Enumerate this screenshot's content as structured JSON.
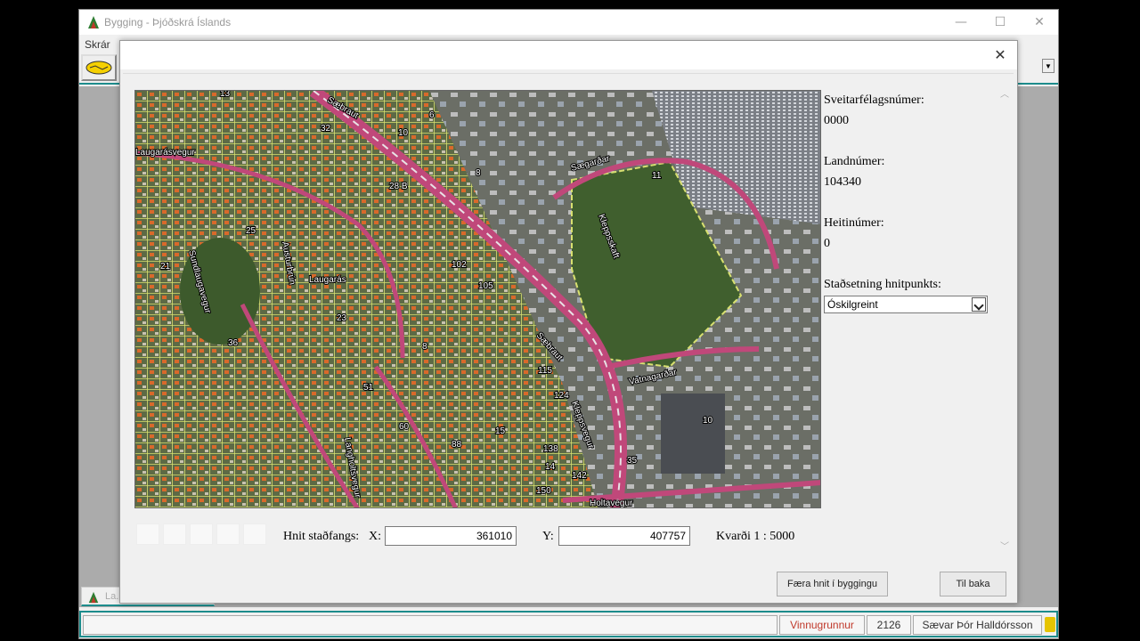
{
  "app": {
    "title": "Bygging - Þjóðskrá Íslands",
    "menu_file": "Skrár",
    "minimize_icon": "minimize-icon",
    "maximize_icon": "maximize-icon",
    "close_icon": "close-icon",
    "minimized_tab_label": "La...",
    "accent_color": "#1d8c8c"
  },
  "status_bar": {
    "message": "",
    "mode": "Vinnugrunnur",
    "mode_color": "#c0392b",
    "number": "2126",
    "user": "Sævar Þór Halldórsson"
  },
  "dialog": {
    "close_glyph": "✕",
    "fields": {
      "sveitarfelag_label": "Sveitarfélagsnúmer:",
      "sveitarfelag_value": "0000",
      "landnumer_label": "Landnúmer:",
      "landnumer_value": "104340",
      "heitinumer_label": "Heitinúmer:",
      "heitinumer_value": "0",
      "stadsetning_label": "Staðsetning hnitpunkts:",
      "stadsetning_value": "Óskilgreint"
    },
    "coords": {
      "label": "Hnit staðfangs:",
      "x_label": "X:",
      "x_value": "361010",
      "y_label": "Y:",
      "y_value": "407757",
      "scale": "Kvarði 1 : 5000"
    },
    "buttons": {
      "move": "Færa hnit í byggingu",
      "back": "Til baka"
    }
  },
  "map": {
    "streets": [
      "Sæbraut",
      "Laugarásvegur",
      "Kleppsskaft",
      "Sægarðar",
      "Vatnagarðar",
      "Holtavegur",
      "Langholtsvegur",
      "Sundlaugavegur",
      "Austurbrún",
      "Kleppsvegur",
      "Langholtsvegur"
    ],
    "district": "Laugarás",
    "house_numbers": [
      "13",
      "32",
      "32",
      "10",
      "8",
      "28 B",
      "6",
      "11",
      "102",
      "105",
      "115",
      "124",
      "10",
      "150",
      "138",
      "142",
      "14",
      "35",
      "36",
      "25",
      "23",
      "51",
      "8",
      "15",
      "60",
      "21",
      "88"
    ]
  }
}
